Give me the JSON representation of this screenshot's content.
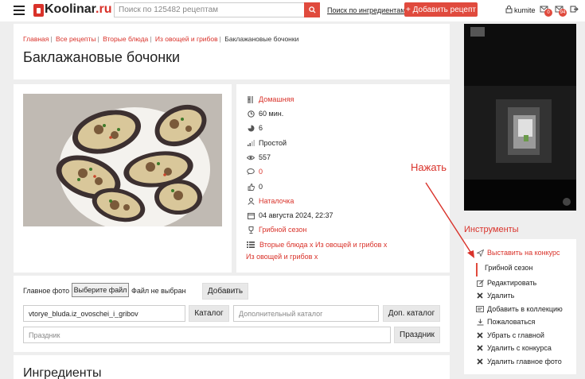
{
  "header": {
    "logo_text": "Koolinar",
    "logo_suffix": ".ru",
    "search_placeholder": "Поиск по 125482 рецептам",
    "ingredients_search": "Поиск по ингредиентам",
    "add_recipe_button": "+ Добавить рецепт",
    "username": "kumite",
    "notifications_count": "0",
    "messages_count": "94"
  },
  "breadcrumb": [
    "Главная",
    "Все рецепты",
    "Вторые блюда",
    "Из овощей и грибов",
    "Баклажановые бочонки"
  ],
  "page_title": "Баклажановые бочонки",
  "info": {
    "cuisine": "Домашняя",
    "time": "60 мин.",
    "servings": "6",
    "difficulty": "Простой",
    "views": "557",
    "comments": "0",
    "likes": "0",
    "author": "Наталочка",
    "date": "04 августа 2024, 22:37",
    "contest": "Грибной сезон",
    "categories_line1": "Вторые блюда x  Из овощей и грибов x",
    "categories_line2": "Из овощей и грибов x"
  },
  "form": {
    "main_photo_label": "Главное фото",
    "choose_file_button": "Выберите файл",
    "file_status": "Файл не выбран",
    "add_button": "Добавить",
    "catalog_value": "vtorye_bluda.iz_ovoschei_i_gribov",
    "catalog_button": "Каталог",
    "extra_catalog_placeholder": "Дополнительный каталог",
    "extra_catalog_button": "Доп. каталог",
    "holiday_placeholder": "Праздник",
    "holiday_button": "Праздник"
  },
  "ingredients_title": "Ингредиенты",
  "tools": {
    "title": "Инструменты",
    "items": [
      {
        "label": "Выставить на конкурс",
        "icon": "send-icon",
        "highlight": true
      },
      {
        "label": "Редактировать",
        "icon": "edit-icon"
      },
      {
        "label": "Удалить",
        "icon": "close-icon"
      },
      {
        "label": "Добавить в коллекцию",
        "icon": "collection-icon"
      },
      {
        "label": "Пожаловаться",
        "icon": "report-icon"
      },
      {
        "label": "Убрать с главной",
        "icon": "close-icon"
      },
      {
        "label": "Удалить с конкурса",
        "icon": "close-icon"
      },
      {
        "label": "Удалить главное фото",
        "icon": "close-icon"
      }
    ],
    "submenu_item": "Грибной сезон"
  },
  "annotation": "Нажать",
  "colors": {
    "accent": "#d9322a",
    "button_red": "#e04a3d",
    "background": "#eeeeee"
  }
}
